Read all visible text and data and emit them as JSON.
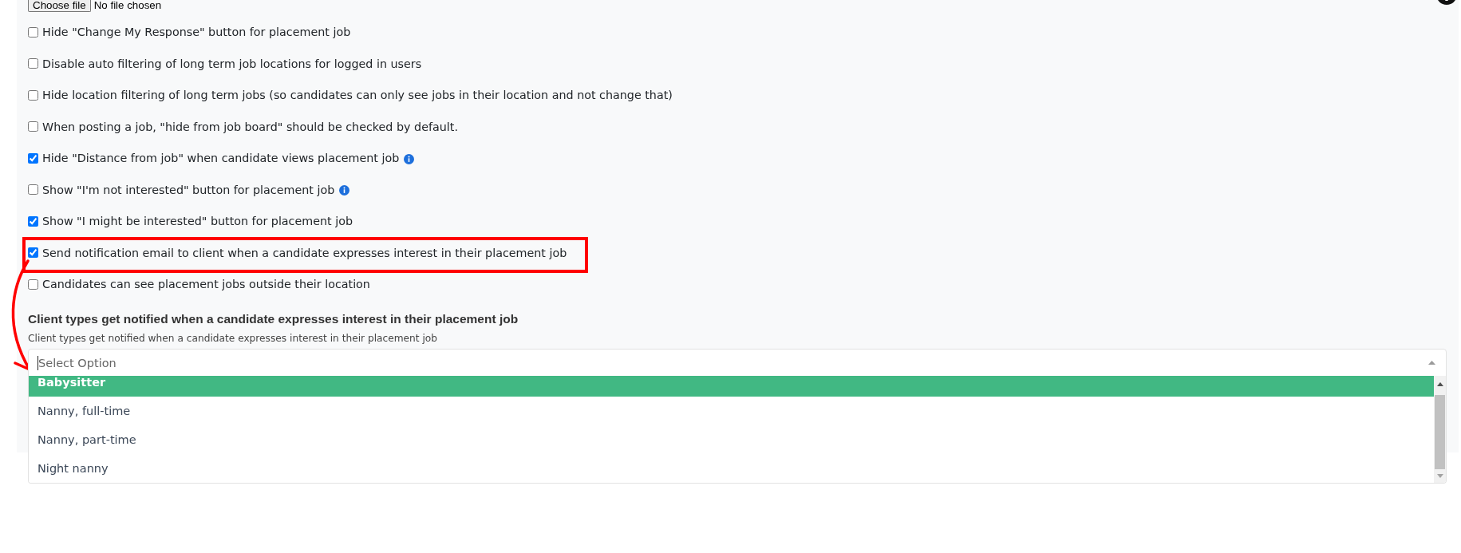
{
  "file_upload": {
    "button_label": "Choose file",
    "status": "No file chosen"
  },
  "options": [
    {
      "label": "Hide \"Change My Response\" button for placement job",
      "checked": false,
      "info": false,
      "highlighted": false
    },
    {
      "label": "Disable auto filtering of long term job locations for logged in users",
      "checked": false,
      "info": false,
      "highlighted": false
    },
    {
      "label": "Hide location filtering of long term jobs (so candidates can only see jobs in their location and not change that)",
      "checked": false,
      "info": false,
      "highlighted": false
    },
    {
      "label": "When posting a job, \"hide from job board\" should be checked by default.",
      "checked": false,
      "info": false,
      "highlighted": false
    },
    {
      "label": "Hide \"Distance from job\" when candidate views placement job",
      "checked": true,
      "info": true,
      "highlighted": false
    },
    {
      "label": "Show \"I'm not interested\" button for placement job",
      "checked": false,
      "info": true,
      "highlighted": false
    },
    {
      "label": "Show \"I might be interested\" button for placement job",
      "checked": true,
      "info": false,
      "highlighted": false
    },
    {
      "label": "Send notification email to client when a candidate expresses interest in their placement job",
      "checked": true,
      "info": false,
      "highlighted": true
    },
    {
      "label": "Candidates can see placement jobs outside their location",
      "checked": false,
      "info": false,
      "highlighted": false
    }
  ],
  "client_types": {
    "title": "Client types get notified when a candidate expresses interest in their placement job",
    "help": "Client types get notified when a candidate expresses interest in their placement job",
    "select": {
      "placeholder": "Select Option",
      "focused": true,
      "expanded": true,
      "options": [
        {
          "label": "Babysitter",
          "selected": true
        },
        {
          "label": "Nanny, full-time",
          "selected": false
        },
        {
          "label": "Nanny, part-time",
          "selected": false
        },
        {
          "label": "Night nanny",
          "selected": false
        }
      ]
    }
  }
}
